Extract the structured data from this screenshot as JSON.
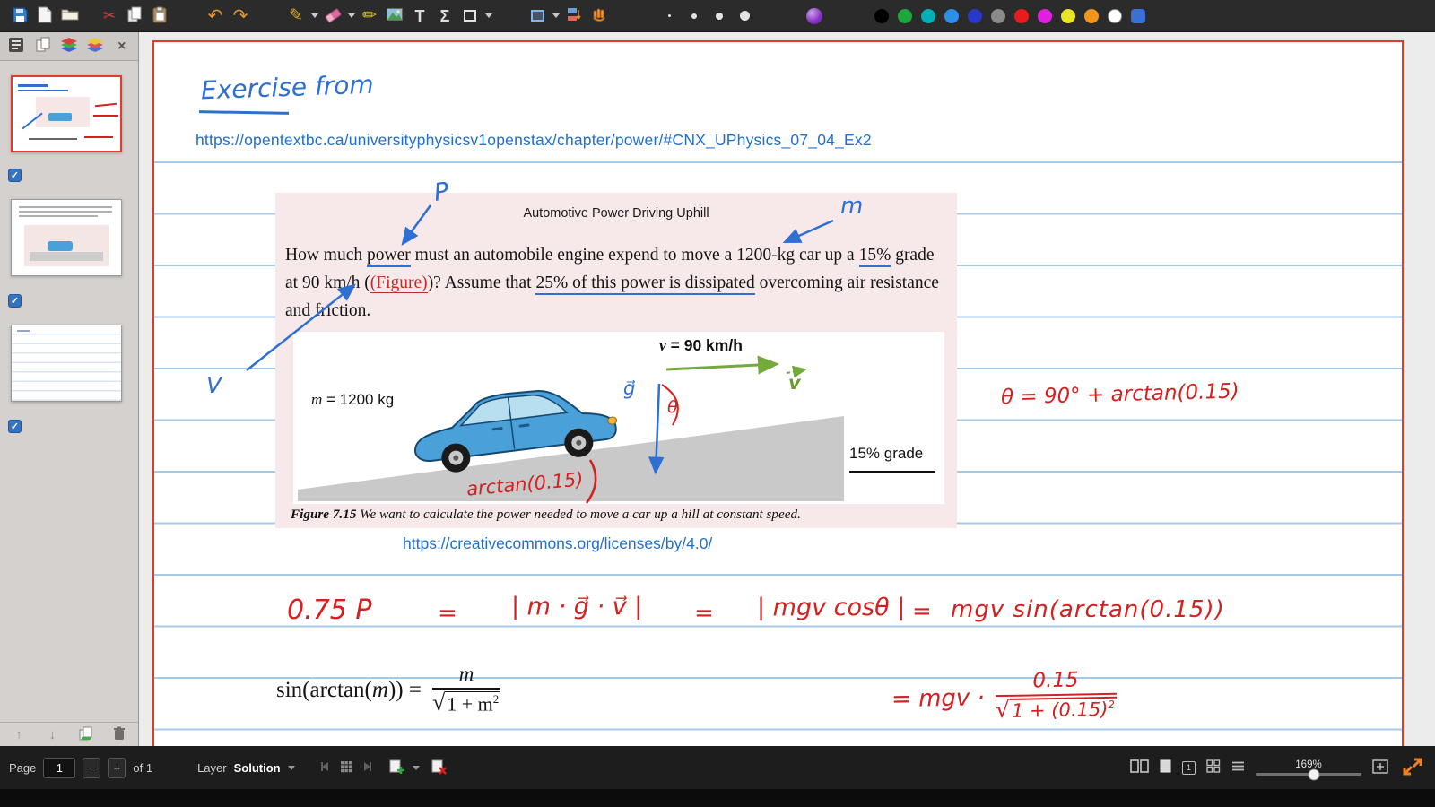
{
  "icons": {
    "cut": "✂",
    "undo": "↶",
    "redo": "↷",
    "pen": "✎",
    "highlighter": "✏",
    "text": "T",
    "math": "Σ",
    "close": "×",
    "check": "✓",
    "up": "↑",
    "down": "↓"
  },
  "toolbar": {
    "palette": [
      "#000000",
      "#1ea83c",
      "#00b0b4",
      "#2e8fe8",
      "#2838c8",
      "#8a8a8a",
      "#e81c1c",
      "#e020e0",
      "#e8e426",
      "#f2941e",
      "#ffffff"
    ],
    "palette_square": "#3a6fd8"
  },
  "page": {
    "heading": "Exercise from",
    "source_url": "https://opentextbc.ca/universityphysicsv1openstax/chapter/power/#CNX_UPhysics_07_04_Ex2",
    "cc_url": "https://creativecommons.org/licenses/by/4.0/",
    "figure": {
      "title": "Automotive Power Driving Uphill",
      "problem": {
        "p1": "How much ",
        "p2": "power",
        "p3": " must an automobile engine expend to move a 1200-kg car up a ",
        "p4": "15%",
        "p5": " grade at 90 km/h (",
        "p6": "(Figure)",
        "p7": ")? Assume that ",
        "p8": "25% of this power is dissipated",
        "p9": " overcoming air resistance and friction."
      },
      "diagram": {
        "mass_var": "m",
        "mass_rest": " = 1200 kg",
        "speed_var": "v",
        "speed_rest": " = 90 km/h",
        "grade": "15% grade",
        "v_vec": "v",
        "g_vec": "g⃗",
        "theta": "θ"
      },
      "caption_label": "Figure 7.15",
      "caption_text": " We want to calculate the power needed to move a car up a hill at constant speed."
    },
    "annotations": {
      "p": "P",
      "m": "m",
      "v": "V",
      "arctan": "arctan(0.15)",
      "theta_eq": "θ = 90° + arctan(0.15)",
      "eq_a": "0.75 P",
      "eq_sign": "=",
      "eq_b": "| m · g⃗ · v⃗ |",
      "eq_c": "| mgv cosθ |",
      "eq_d": "mgv sin(arctan(0.15))",
      "eq2_lead": "= mgv ·",
      "eq2_num": "0.15",
      "eq2_root": "√",
      "eq2_den": "1 + (0.15)",
      "eq2_sup": "2"
    },
    "math": {
      "lhs1": "sin(arctan(",
      "var": "m",
      "lhs2": ")) =",
      "num": "m",
      "root": "√",
      "den": "1 + m",
      "sup": "2"
    }
  },
  "statusbar": {
    "page_label": "Page",
    "page_value": "1",
    "minus": "−",
    "plus": "+",
    "of_label": "of 1",
    "layer_label": "Layer",
    "layer_value": "Solution",
    "zoom": "169%",
    "page_badge": "1"
  }
}
